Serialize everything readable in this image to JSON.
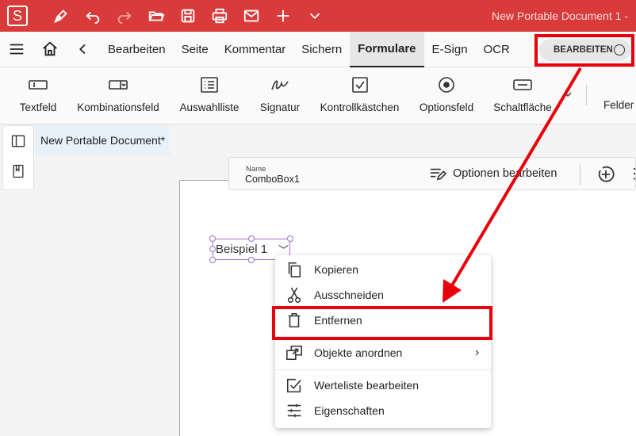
{
  "app": {
    "logo_letter": "S",
    "window_title": "New Portable Document 1  -",
    "brand_color": "#d93b3b"
  },
  "titlebar_icons": [
    "pen-icon",
    "undo-icon",
    "redo-icon",
    "open-folder-icon",
    "save-icon",
    "print-icon",
    "mail-icon",
    "plus-icon",
    "chevron-down-icon"
  ],
  "menu": {
    "items": [
      "Bearbeiten",
      "Seite",
      "Kommentar",
      "Sichern",
      "Formulare",
      "E-Sign",
      "OCR"
    ],
    "active": "Formulare",
    "edit_toggle_label": "BEARBEITEN"
  },
  "ribbon": {
    "items": [
      "Textfeld",
      "Kombinationsfeld",
      "Auswahlliste",
      "Signatur",
      "Kontrollkästchen",
      "Optionsfeld",
      "Schaltfläche",
      "Felder l"
    ]
  },
  "document": {
    "tab_title": "New Portable Document*"
  },
  "properties": {
    "name_label": "Name",
    "name_value": "ComboBox1",
    "options_label": "Optionen bearbeiten"
  },
  "combo": {
    "value": "Beispiel 1"
  },
  "context_menu": {
    "items": [
      {
        "label": "Kopieren",
        "icon": "copy-icon"
      },
      {
        "label": "Ausschneiden",
        "icon": "scissors-icon"
      },
      {
        "label": "Entfernen",
        "icon": "trash-icon"
      },
      {
        "label": "Objekte anordnen",
        "icon": "arrange-icon"
      },
      {
        "label": "Werteliste bearbeiten",
        "icon": "checkbox-edit-icon"
      },
      {
        "label": "Eigenschaften",
        "icon": "sliders-icon"
      }
    ]
  },
  "annotation_color": "#e8000b"
}
